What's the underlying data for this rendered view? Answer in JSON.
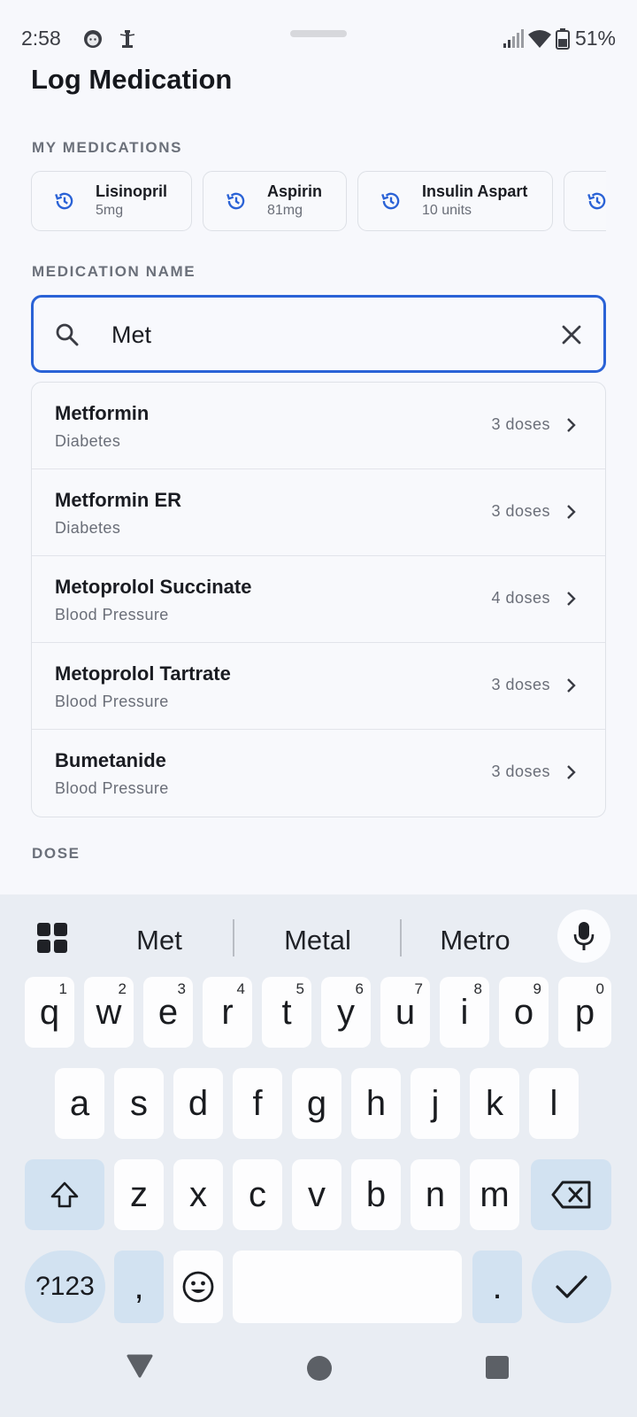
{
  "status_bar": {
    "time": "2:58",
    "battery": "51%",
    "icons": [
      "face-notification-icon",
      "lighthouse-notification-icon",
      "signal-icon",
      "wifi-icon",
      "battery-icon"
    ]
  },
  "page": {
    "title": "Log Medication",
    "my_medications_label": "MY MEDICATIONS",
    "medication_name_label": "MEDICATION NAME",
    "dose_label": "DOSE"
  },
  "recent_medications": [
    {
      "name": "Lisinopril",
      "dose": "5mg"
    },
    {
      "name": "Aspirin",
      "dose": "81mg"
    },
    {
      "name": "Insulin Aspart",
      "dose": "10 units"
    }
  ],
  "search": {
    "value": "Met",
    "placeholder": ""
  },
  "suggestions": [
    {
      "name": "Metformin",
      "category": "Diabetes",
      "doses": "3 doses"
    },
    {
      "name": "Metformin ER",
      "category": "Diabetes",
      "doses": "3 doses"
    },
    {
      "name": "Metoprolol Succinate",
      "category": "Blood Pressure",
      "doses": "4 doses"
    },
    {
      "name": "Metoprolol Tartrate",
      "category": "Blood Pressure",
      "doses": "3 doses"
    },
    {
      "name": "Bumetanide",
      "category": "Blood Pressure",
      "doses": "3 doses"
    }
  ],
  "keyboard": {
    "suggestions": [
      "Met",
      "Metal",
      "Metro"
    ],
    "row1": [
      {
        "key": "q",
        "hint": "1"
      },
      {
        "key": "w",
        "hint": "2"
      },
      {
        "key": "e",
        "hint": "3"
      },
      {
        "key": "r",
        "hint": "4"
      },
      {
        "key": "t",
        "hint": "5"
      },
      {
        "key": "y",
        "hint": "6"
      },
      {
        "key": "u",
        "hint": "7"
      },
      {
        "key": "i",
        "hint": "8"
      },
      {
        "key": "o",
        "hint": "9"
      },
      {
        "key": "p",
        "hint": "0"
      }
    ],
    "row2": [
      "a",
      "s",
      "d",
      "f",
      "g",
      "h",
      "j",
      "k",
      "l"
    ],
    "row3": [
      "z",
      "x",
      "c",
      "v",
      "b",
      "n",
      "m"
    ],
    "symbols_label": "?123",
    "comma": ",",
    "period": "."
  },
  "colors": {
    "accent": "#2a62d6",
    "keyboard_bg": "#e9edf3",
    "modifier_key": "#d2e2f1"
  }
}
